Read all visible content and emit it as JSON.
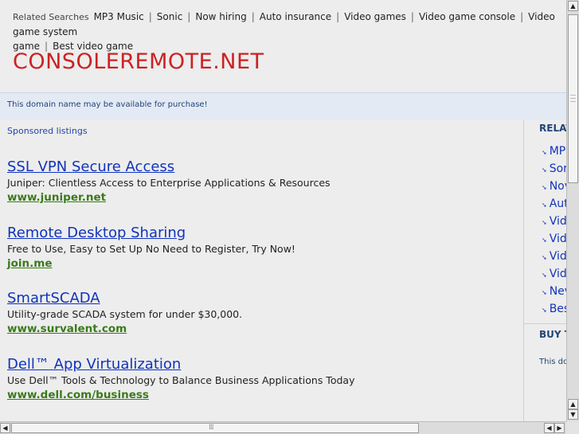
{
  "related_searches": {
    "label": "Related Searches",
    "items": [
      "MP3 Music",
      "Sonic",
      "Now hiring",
      "Auto insurance",
      "Video games",
      "Video game console",
      "Video game system",
      "game",
      "Best video game"
    ]
  },
  "site_title": "CONSOLEREMOTE.NET",
  "availability_text": "This domain name may be available for purchase!",
  "sponsored_label": "Sponsored listings",
  "listings": [
    {
      "title": "SSL VPN Secure Access",
      "description": "Juniper: Clientless Access to Enterprise Applications & Resources",
      "url": "www.juniper.net"
    },
    {
      "title": "Remote Desktop Sharing",
      "description": "Free to Use, Easy to Set Up No Need to Register, Try Now!",
      "url": "join.me"
    },
    {
      "title": "SmartSCADA",
      "description": "Utility-grade SCADA system for under $30,000.",
      "url": "www.survalent.com"
    },
    {
      "title": "Dell™ App Virtualization",
      "description": "Use Dell™ Tools & Technology to Balance Business Applications Today",
      "url": "www.dell.com/business"
    }
  ],
  "right_column": {
    "heading": "RELAT",
    "items": [
      "MP",
      "Sor",
      "Nov",
      "Aut",
      "Vid",
      "Vid",
      "Vid",
      "Vid",
      "Nev",
      "Bes"
    ],
    "buy_heading": "BUY T",
    "buy_text": "This dor"
  },
  "colors": {
    "title_red": "#cc2222",
    "link_blue": "#1133bb",
    "url_green": "#3a7a1a",
    "bar_blue": "#e3eaf4"
  }
}
